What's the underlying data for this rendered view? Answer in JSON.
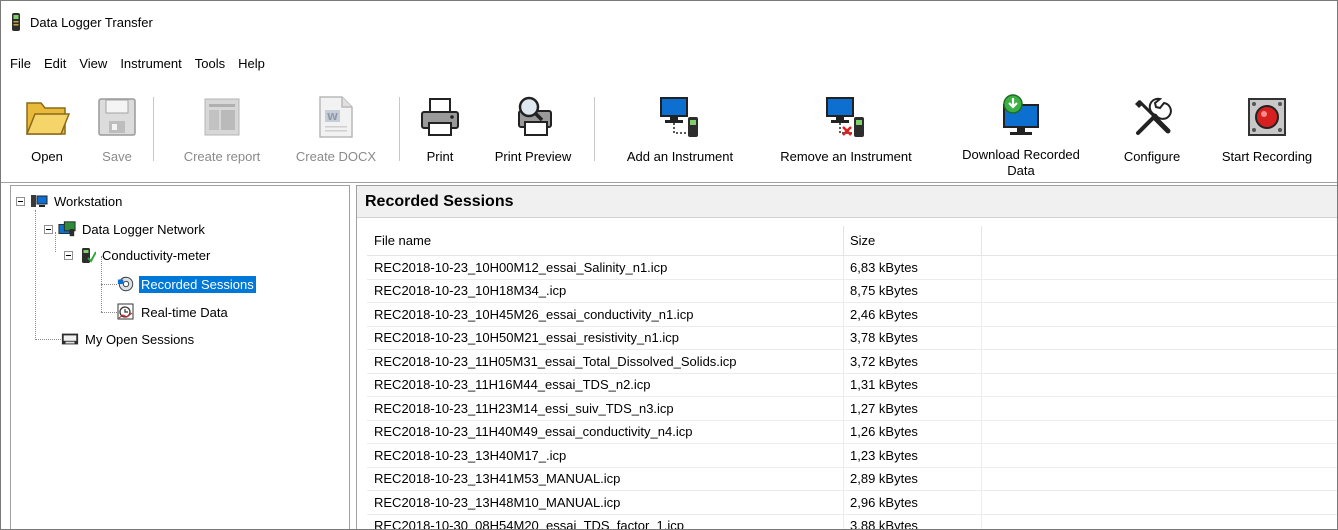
{
  "window": {
    "title": "Data Logger Transfer"
  },
  "menu": [
    "File",
    "Edit",
    "View",
    "Instrument",
    "Tools",
    "Help"
  ],
  "toolbar": {
    "open": "Open",
    "save": "Save",
    "create_report": "Create report",
    "create_docx": "Create DOCX",
    "print": "Print",
    "print_preview": "Print Preview",
    "add_instrument": "Add an Instrument",
    "remove_instrument": "Remove an Instrument",
    "download_line1": "Download Recorded",
    "download_line2": "Data",
    "configure": "Configure",
    "start_recording": "Start Recording"
  },
  "tree": {
    "workstation": "Workstation",
    "network": "Data Logger Network",
    "meter": "Conductivity-meter",
    "recorded": "Recorded Sessions",
    "realtime": "Real-time Data",
    "open_sessions": "My Open Sessions"
  },
  "panel": {
    "title": "Recorded Sessions",
    "col_file": "File name",
    "col_size": "Size",
    "rows": [
      {
        "file": "REC2018-10-23_10H00M12_essai_Salinity_n1.icp",
        "size": "6,83 kBytes"
      },
      {
        "file": "REC2018-10-23_10H18M34_.icp",
        "size": "8,75 kBytes"
      },
      {
        "file": "REC2018-10-23_10H45M26_essai_conductivity_n1.icp",
        "size": "2,46 kBytes"
      },
      {
        "file": "REC2018-10-23_10H50M21_essai_resistivity_n1.icp",
        "size": "3,78 kBytes"
      },
      {
        "file": "REC2018-10-23_11H05M31_essai_Total_Dissolved_Solids.icp",
        "size": "3,72 kBytes"
      },
      {
        "file": "REC2018-10-23_11H16M44_essai_TDS_n2.icp",
        "size": "1,31 kBytes"
      },
      {
        "file": "REC2018-10-23_11H23M14_essi_suiv_TDS_n3.icp",
        "size": "1,27 kBytes"
      },
      {
        "file": "REC2018-10-23_11H40M49_essai_conductivity_n4.icp",
        "size": "1,26 kBytes"
      },
      {
        "file": "REC2018-10-23_13H40M17_.icp",
        "size": "1,23 kBytes"
      },
      {
        "file": "REC2018-10-23_13H41M53_MANUAL.icp",
        "size": "2,89 kBytes"
      },
      {
        "file": "REC2018-10-23_13H48M10_MANUAL.icp",
        "size": "2,96 kBytes"
      },
      {
        "file": "REC2018-10-30_08H54M20_essai_TDS_factor_1.icp",
        "size": "3,88 kBytes"
      }
    ]
  },
  "colors": {
    "selection": "#0078d7",
    "record_red": "#d61f1f"
  }
}
